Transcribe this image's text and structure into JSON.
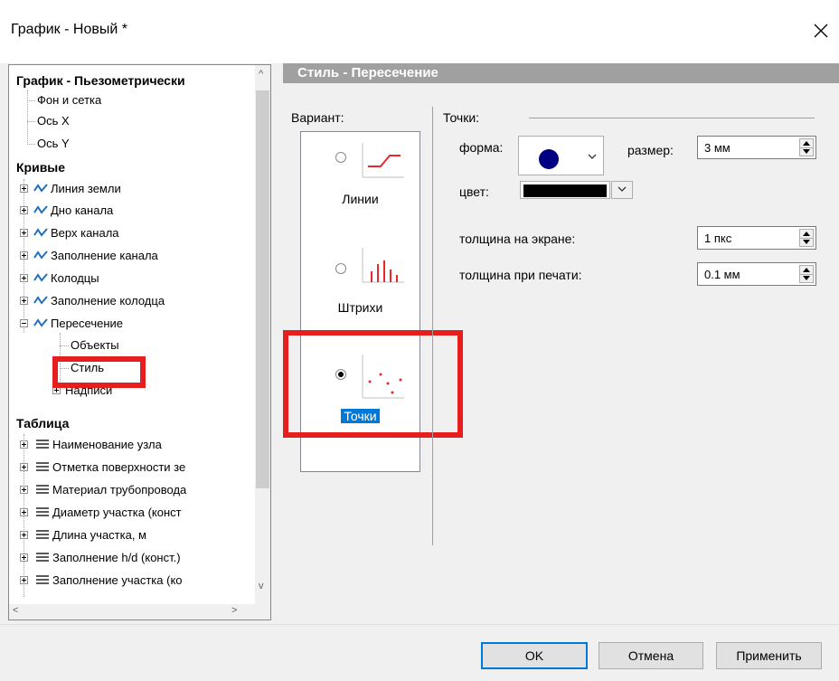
{
  "window": {
    "title": "График - Новый *"
  },
  "tree": {
    "root": "График - Пьезометрически",
    "root_children": [
      "Фон и сетка",
      "Ось X",
      "Ось Y"
    ],
    "curves_header": "Кривые",
    "curves": [
      "Линия земли",
      "Дно канала",
      "Верх канала",
      "Заполнение канала",
      "Колодцы",
      "Заполнение колодца",
      "Пересечение"
    ],
    "intersection_children": [
      "Объекты",
      "Стиль",
      "Надписи"
    ],
    "table_header": "Таблица",
    "table_items": [
      "Наименование узла",
      "Отметка поверхности зе",
      "Материал трубопровода",
      "Диаметр участка (конст",
      "Длина участка, м",
      "Заполнение h/d (конст.)",
      "Заполнение участка (ко"
    ]
  },
  "panel": {
    "header": "Стиль - Пересечение",
    "variant_label": "Вариант:",
    "options": [
      {
        "label": "Линии",
        "selected": false
      },
      {
        "label": "Штрихи",
        "selected": false
      },
      {
        "label": "Точки",
        "selected": true
      }
    ],
    "points_label": "Точки:",
    "shape_label": "форма:",
    "size_label": "размер:",
    "size_value": "3 мм",
    "color_label": "цвет:",
    "screen_thickness_label": "толщина на экране:",
    "screen_thickness_value": "1 пкс",
    "print_thickness_label": "толщина при печати:",
    "print_thickness_value": "0.1 мм",
    "shape_color": "#000080",
    "line_color": "#000000"
  },
  "buttons": {
    "ok": "OK",
    "cancel": "Отмена",
    "apply": "Применить"
  },
  "colors": {
    "highlight": "#e61e1e",
    "accent": "#0078d7",
    "icon_red": "#e8282c"
  }
}
